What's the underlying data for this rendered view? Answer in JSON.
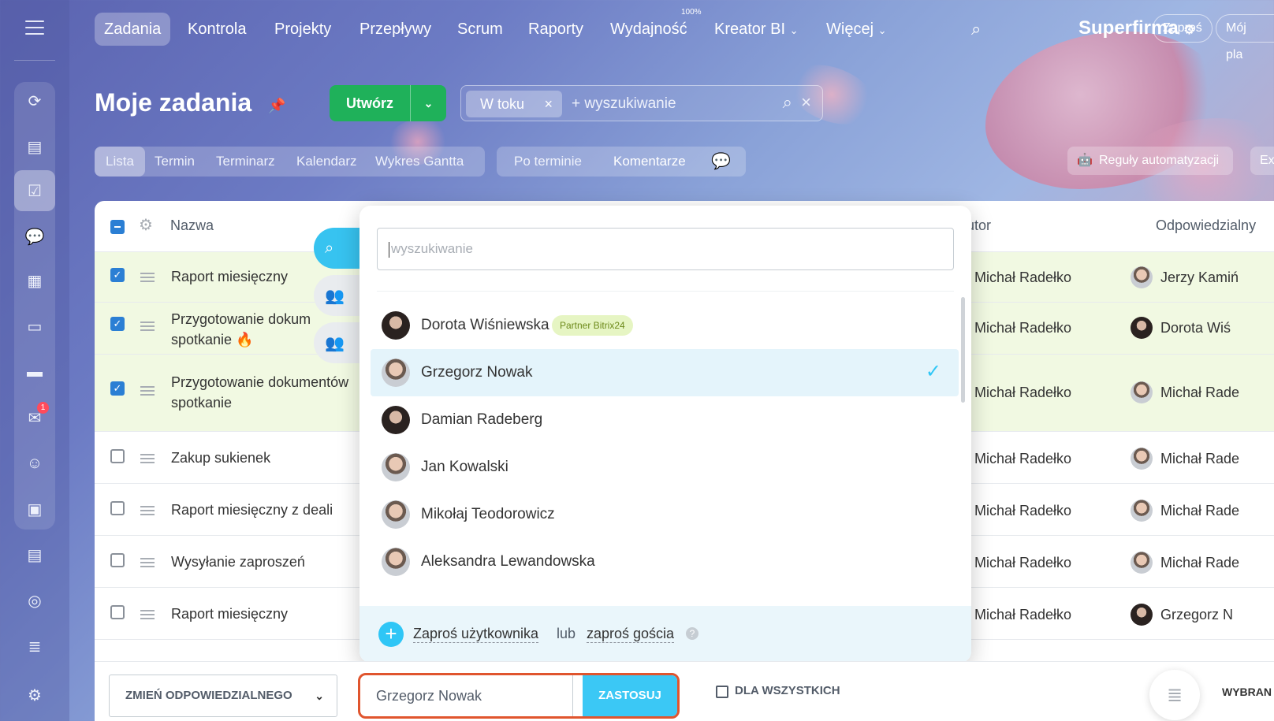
{
  "nav": {
    "items": [
      "Zadania",
      "Kontrola",
      "Projekty",
      "Przepływy",
      "Scrum",
      "Raporty",
      "Wydajność",
      "Kreator BI",
      "Więcej"
    ],
    "efficiency_sup": "100%",
    "brand": "Superfirma",
    "invite": "Zaproś",
    "my_plan": "Mój pla"
  },
  "sidebar": {
    "icons": [
      "hub-icon",
      "feed-icon",
      "tasks-icon",
      "chat-icon",
      "calendar-icon",
      "docs-icon",
      "drive-icon",
      "mail-icon",
      "contacts-icon",
      "board-icon",
      "crm-icon",
      "goals-icon",
      "filter-icon",
      "settings-icon"
    ],
    "mail_badge": "1"
  },
  "page": {
    "title": "Moje zadania",
    "create_label": "Utwórz",
    "filter_chip": "W toku",
    "filter_placeholder": "+ wyszukiwanie"
  },
  "views": {
    "tabs": [
      "Lista",
      "Termin",
      "Terminarz",
      "Kalendarz",
      "Wykres Gantta"
    ],
    "counters": [
      "Po terminie",
      "Komentarze"
    ],
    "automation": "Reguły automatyzacji",
    "export": "Ex"
  },
  "table": {
    "headers": {
      "name": "Nazwa",
      "author": "utor",
      "responsible": "Odpowiedzialny"
    },
    "rows": [
      {
        "name": "Raport miesięczny",
        "author": "Michał Radełko",
        "responsible": "Jerzy Kamiń",
        "checked": true
      },
      {
        "name": "Przygotowanie dokum spotkanie",
        "author": "Michał Radełko",
        "responsible": "Dorota Wiś",
        "checked": true
      },
      {
        "name": "Przygotowanie dokumentów spotkanie",
        "author": "Michał Radełko",
        "responsible": "Michał Rade",
        "checked": true
      },
      {
        "name": "Zakup sukienek",
        "author": "Michał Radełko",
        "responsible": "Michał Rade",
        "checked": false
      },
      {
        "name": "Raport miesięczny z deali",
        "author": "Michał Radełko",
        "responsible": "Michał Rade",
        "checked": false
      },
      {
        "name": "Wysyłanie zaproszeń",
        "author": "Michał Radełko",
        "responsible": "Michał Rade",
        "checked": false
      },
      {
        "name": "Raport miesięczny",
        "author": "Michał Radełko",
        "responsible": "Grzegorz N",
        "checked": false
      }
    ]
  },
  "popup": {
    "search_placeholder": "wyszukiwanie",
    "users": [
      {
        "name": "Dorota Wiśniewska",
        "badge": "Partner Bitrix24"
      },
      {
        "name": "Grzegorz Nowak",
        "selected": true
      },
      {
        "name": "Damian Radeberg"
      },
      {
        "name": "Jan Kowalski"
      },
      {
        "name": "Mikołaj Teodorowicz"
      },
      {
        "name": "Aleksandra Lewandowska"
      }
    ],
    "invite_user": "Zaproś użytkownika",
    "or": "lub",
    "invite_guest": "zaproś gościa",
    "help": "?"
  },
  "bottom": {
    "action": "ZMIEŃ ODPOWIEDZIALNEGO",
    "value": "Grzegorz Nowak",
    "apply": "ZASTOSUJ",
    "for_all": "DLA WSZYSTKICH",
    "selected": "WYBRAN"
  }
}
